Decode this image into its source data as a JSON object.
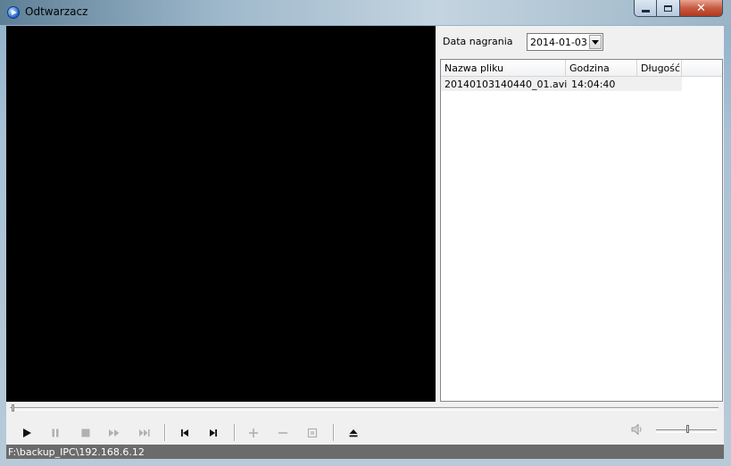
{
  "window": {
    "title": "Odtwarzacz",
    "controls": {
      "minimize_icon": "minimize-icon",
      "maximize_icon": "maximize-icon",
      "close_icon": "close-icon"
    }
  },
  "filter": {
    "date_label": "Data nagrania",
    "date_value": "2014-01-03"
  },
  "file_list": {
    "columns": [
      "Nazwa pliku",
      "Godzina",
      "Długość"
    ],
    "rows": [
      {
        "name": "20140103140440_01.avi",
        "time": "14:04:40",
        "duration": ""
      }
    ]
  },
  "playback": {
    "position": 0,
    "volume": 0.5,
    "buttons": [
      {
        "name": "play-button",
        "icon": "play-icon",
        "enabled": true
      },
      {
        "name": "pause-button",
        "icon": "pause-icon",
        "enabled": false
      },
      {
        "name": "stop-button",
        "icon": "stop-icon",
        "enabled": false
      },
      {
        "name": "fast-forward-button",
        "icon": "fast-forward-icon",
        "enabled": false
      },
      {
        "name": "skip-end-button",
        "icon": "skip-end-icon",
        "enabled": false
      },
      {
        "name": "previous-button",
        "icon": "previous-icon",
        "enabled": true
      },
      {
        "name": "next-button",
        "icon": "next-icon",
        "enabled": true
      },
      {
        "name": "zoom-in-button",
        "icon": "plus-icon",
        "enabled": false
      },
      {
        "name": "zoom-out-button",
        "icon": "minus-icon",
        "enabled": false
      },
      {
        "name": "fullscreen-button",
        "icon": "fullscreen-icon",
        "enabled": false
      },
      {
        "name": "eject-button",
        "icon": "eject-icon",
        "enabled": true
      }
    ]
  },
  "status": {
    "path": "F:\\backup_IPC\\192.168.6.12"
  }
}
